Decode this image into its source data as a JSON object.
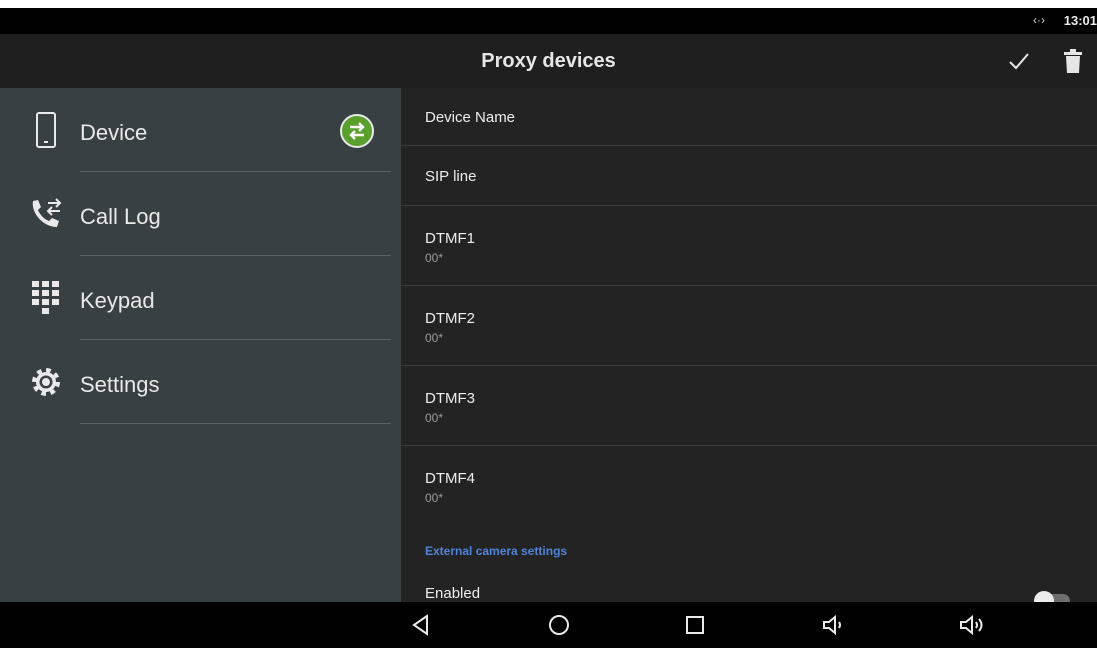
{
  "status_bar": {
    "network_indicator": "‹·›",
    "time": "13:01"
  },
  "header": {
    "title": "Proxy devices",
    "confirm_icon": "check-icon",
    "delete_icon": "trash-icon"
  },
  "sidebar": {
    "items": [
      {
        "label": "Device",
        "icon": "smartphone-icon",
        "badge": "sync-arrows-icon"
      },
      {
        "label": "Call Log",
        "icon": "call-log-icon"
      },
      {
        "label": "Keypad",
        "icon": "dialpad-icon"
      },
      {
        "label": "Settings",
        "icon": "gear-icon"
      }
    ]
  },
  "settings": {
    "rows": [
      {
        "title": "Device Name",
        "value": ""
      },
      {
        "title": "SIP line",
        "value": ""
      },
      {
        "title": "DTMF1",
        "value": "00*"
      },
      {
        "title": "DTMF2",
        "value": "00*"
      },
      {
        "title": "DTMF3",
        "value": "00*"
      },
      {
        "title": "DTMF4",
        "value": "00*"
      }
    ],
    "section_header": "External camera settings",
    "enabled": {
      "label": "Enabled",
      "on": false
    }
  },
  "nav_bar": [
    "back-icon",
    "home-icon",
    "recents-icon",
    "volume-down-icon",
    "volume-up-icon"
  ],
  "colors": {
    "sidebar_bg": "#394043",
    "accent": "#4f83d9",
    "badge": "#5aa02c"
  }
}
